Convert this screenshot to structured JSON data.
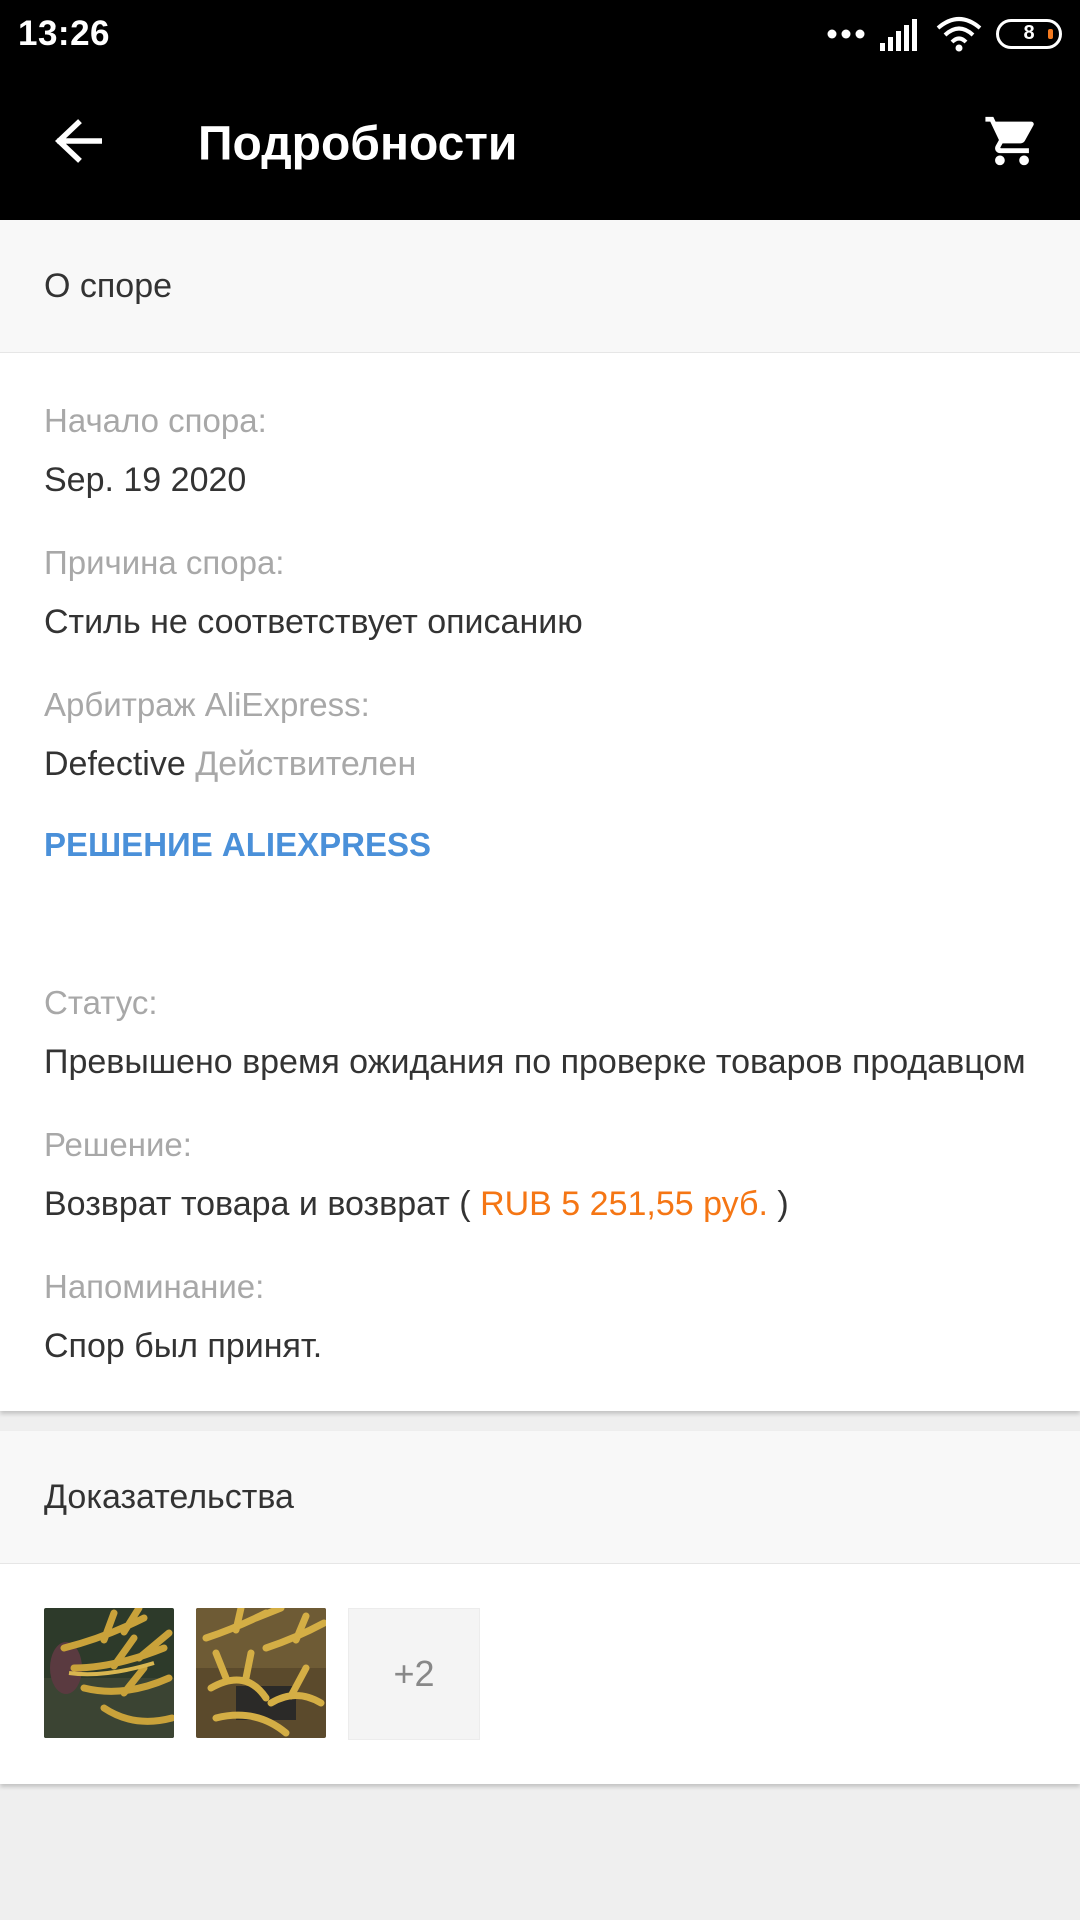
{
  "status_bar": {
    "time": "13:26",
    "battery_level": "8",
    "icons": [
      "dots-icon",
      "signal-icon",
      "wifi-icon",
      "battery-icon"
    ]
  },
  "app_bar": {
    "title": "Подробности",
    "back_icon": "arrow-left-icon",
    "cart_icon": "cart-icon"
  },
  "dispute": {
    "header": "О споре",
    "start_label": "Начало спора:",
    "start_value": "Sep. 19 2020",
    "reason_label": "Причина спора:",
    "reason_value": "Стиль не соответствует описанию",
    "arbitration_label": "Арбитраж AliExpress:",
    "arbitration_value": "Defective",
    "arbitration_status": "Действителен",
    "resolution_link": "РЕШЕНИЕ ALIEXPRESS",
    "status_label": "Статус:",
    "status_value": "Превышено время ожидания по проверке товаров продавцом",
    "decision_label": "Решение:",
    "decision_prefix": "Возврат товара и возврат (",
    "decision_amount": "RUB 5 251,55 руб.",
    "decision_suffix": ")",
    "reminder_label": "Напоминание:",
    "reminder_value": "Спор был принят."
  },
  "evidence": {
    "header": "Доказательства",
    "more_count": "+2"
  },
  "colors": {
    "accent_blue": "#4a90d9",
    "amount_orange": "#f57614",
    "bar_black": "#000000"
  }
}
